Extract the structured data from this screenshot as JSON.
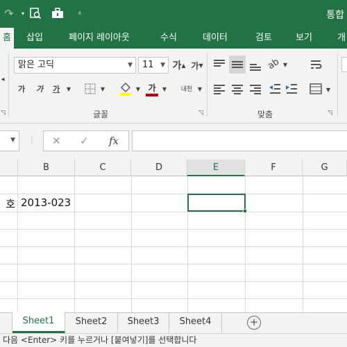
{
  "title_bar": {
    "title": "통합",
    "quick_access": {
      "redo_icon": "redo-icon",
      "more_icon": "chevron-down-icon",
      "print_preview_icon": "print-preview-icon",
      "custom_icon": "toolbox-icon",
      "customize_icon": "customize-qat-icon"
    }
  },
  "ribbon": {
    "tabs": [
      {
        "label": "홈",
        "visible": "홈",
        "active": true
      },
      {
        "label": "삽입"
      },
      {
        "label": "페이지 레이아웃"
      },
      {
        "label": "수식"
      },
      {
        "label": "데이터"
      },
      {
        "label": "검토"
      },
      {
        "label": "보기"
      },
      {
        "label": "개"
      }
    ],
    "font_group": {
      "label": "글꼴",
      "font_name": "맑은 고딕",
      "font_size": "11",
      "grow_font": "가",
      "shrink_font": "가",
      "bold": "가",
      "italic": "가",
      "underline": "가",
      "fill_color": "#ffff00",
      "font_color_label": "가",
      "font_color": "#c00000",
      "phonetic": "내천"
    },
    "alignment_group": {
      "label": "맞춤"
    }
  },
  "formula_bar": {
    "cancel": "✕",
    "enter": "✓",
    "fx": "fx",
    "value": ""
  },
  "grid": {
    "columns": [
      "B",
      "C",
      "D",
      "E",
      "F",
      "G"
    ],
    "selected_column": "E",
    "cells": {
      "A2": "호",
      "B2": "2013-023"
    }
  },
  "sheets": {
    "tabs": [
      "Sheet1",
      "Sheet2",
      "Sheet3",
      "Sheet4"
    ],
    "active": "Sheet1",
    "add": "⊕"
  },
  "status_bar": {
    "message": "다음 <Enter> 키를 누르거나 [붙여넣기]를 선택합니다"
  }
}
